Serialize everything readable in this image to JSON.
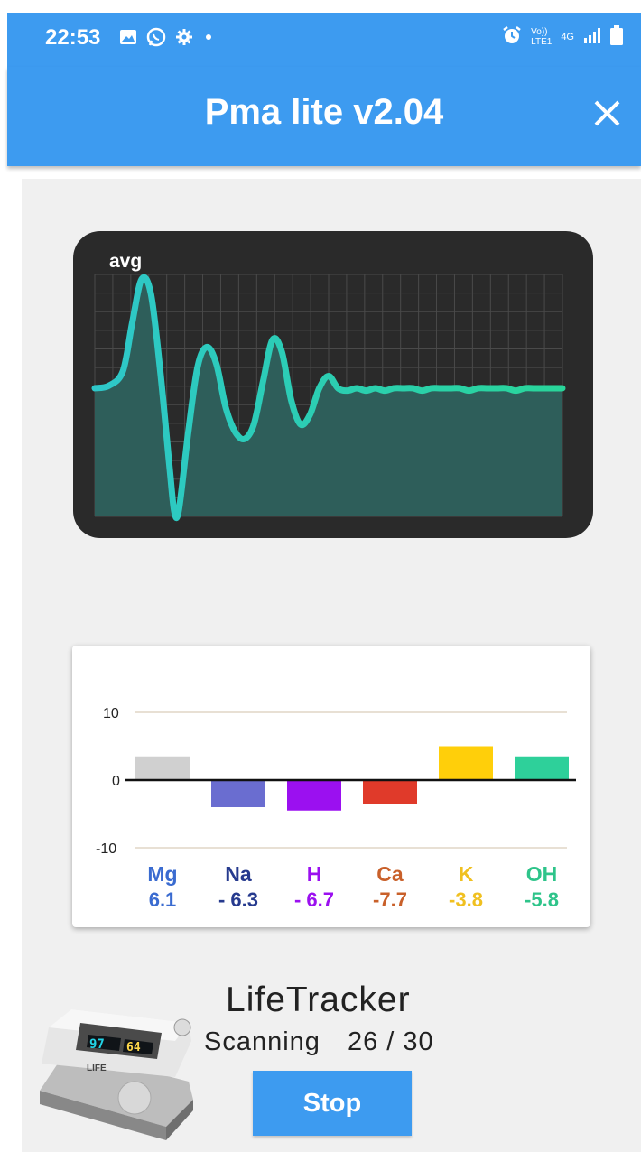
{
  "status_bar": {
    "time": "22:53",
    "network_top": "Vo))",
    "network_bottom": "LTE1",
    "net_gen": "4G"
  },
  "app": {
    "title": "Pma lite v2.04",
    "close_icon": "close-icon"
  },
  "graph": {
    "label": "avg",
    "fill_color": "#2e5e5a",
    "line_color_start": "#2ec7c9",
    "line_color_end": "#29d59a",
    "ylim": [
      0,
      100
    ],
    "points": [
      [
        0,
        53
      ],
      [
        3,
        54
      ],
      [
        6,
        60
      ],
      [
        8,
        80
      ],
      [
        10,
        98
      ],
      [
        12,
        92
      ],
      [
        14,
        60
      ],
      [
        16,
        20
      ],
      [
        17,
        2
      ],
      [
        18,
        3
      ],
      [
        20,
        35
      ],
      [
        22,
        62
      ],
      [
        24,
        70
      ],
      [
        26,
        63
      ],
      [
        28,
        45
      ],
      [
        30,
        35
      ],
      [
        32,
        32
      ],
      [
        34,
        38
      ],
      [
        36,
        56
      ],
      [
        38,
        73
      ],
      [
        40,
        68
      ],
      [
        42,
        48
      ],
      [
        44,
        38
      ],
      [
        46,
        42
      ],
      [
        48,
        53
      ],
      [
        50,
        58
      ],
      [
        52,
        53
      ],
      [
        54,
        52
      ],
      [
        56,
        53
      ],
      [
        58,
        52
      ],
      [
        60,
        53
      ],
      [
        62,
        52
      ],
      [
        64,
        53
      ],
      [
        66,
        53
      ],
      [
        68,
        53
      ],
      [
        70,
        52
      ],
      [
        72,
        53
      ],
      [
        74,
        53
      ],
      [
        76,
        53
      ],
      [
        78,
        53
      ],
      [
        80,
        52
      ],
      [
        82,
        53
      ],
      [
        84,
        53
      ],
      [
        86,
        53
      ],
      [
        88,
        53
      ],
      [
        90,
        52
      ],
      [
        92,
        53
      ],
      [
        94,
        53
      ],
      [
        96,
        53
      ],
      [
        98,
        53
      ],
      [
        100,
        53
      ]
    ]
  },
  "chart_data": {
    "type": "bar",
    "categories": [
      "Mg",
      "Na",
      "H",
      "Ca",
      "K",
      "OH"
    ],
    "values": [
      3.5,
      -4,
      -4.5,
      -3.5,
      5,
      3.5
    ],
    "labels": [
      "6.1",
      "- 6.3",
      "- 6.7",
      "-7.7",
      "-3.8",
      "-5.8"
    ],
    "colors": [
      "#d0d0d0",
      "#6a6dd0",
      "#9b10f0",
      "#e03a2a",
      "#ffcf0a",
      "#2ed09a"
    ],
    "name_colors": [
      "#3a6bd0",
      "#263a8e",
      "#9b10f0",
      "#c9602a",
      "#f0c020",
      "#2ec48a"
    ],
    "ylim": [
      -10,
      10
    ],
    "yticks": [
      "10",
      "0",
      "-10"
    ]
  },
  "device_info": {
    "name": "LifeTracker",
    "status": "Scanning",
    "progress_text": "26 / 30",
    "stop_label": "Stop"
  }
}
